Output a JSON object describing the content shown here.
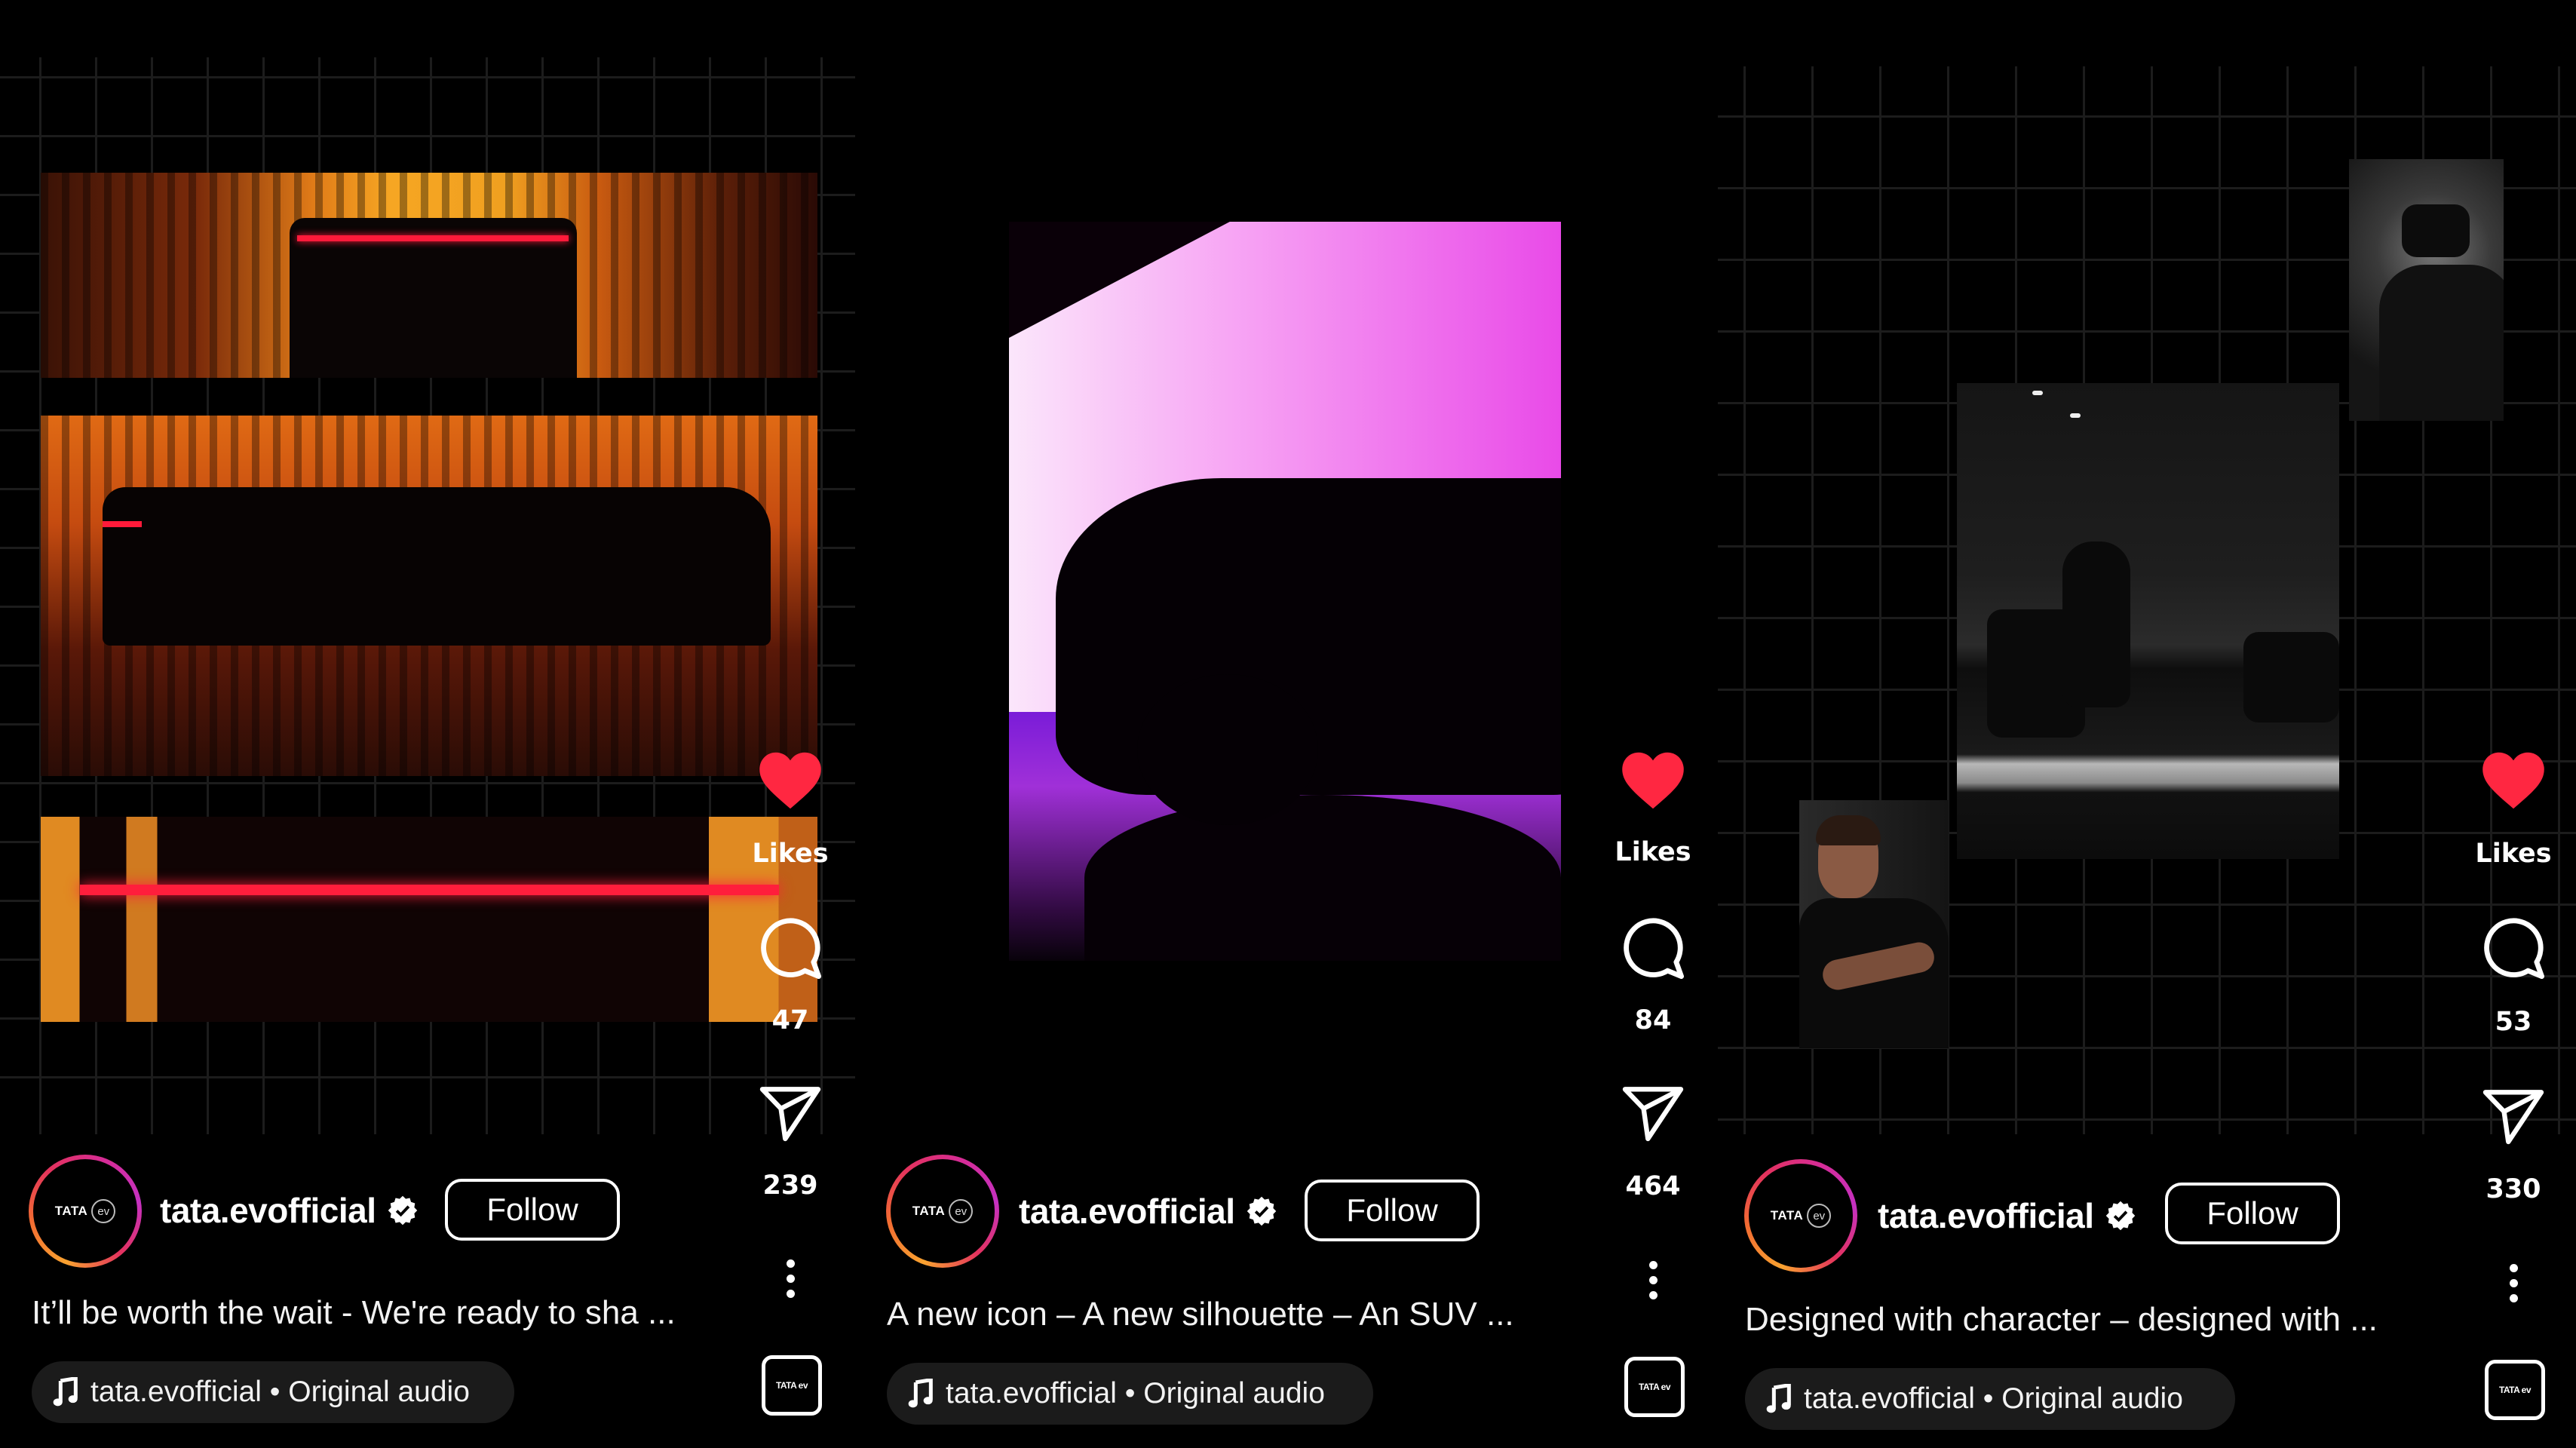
{
  "colors": {
    "background": "#000000",
    "like_red": "#ff2741",
    "text": "#ffffff",
    "pill_bg": "#1b1b1b"
  },
  "reels": [
    {
      "account": {
        "username": "tata.evofficial",
        "verified": true,
        "avatar_logo": "TATA",
        "avatar_logo_badge": "ev"
      },
      "follow_label": "Follow",
      "caption": "It’ll be worth the wait - We're ready to sha ...",
      "audio": {
        "icon": "music-note-icon",
        "text": "tata.evofficial • Original audio",
        "thumb_logo": "TATA ev"
      },
      "actions": {
        "like_icon": "heart-filled-icon",
        "likes_label": "Likes",
        "comments_icon": "comment-icon",
        "comments": "47",
        "share_icon": "send-icon",
        "shares": "239",
        "more_icon": "more-vertical-icon"
      },
      "media": "orange light-streak video frames"
    },
    {
      "account": {
        "username": "tata.evofficial",
        "verified": true,
        "avatar_logo": "TATA",
        "avatar_logo_badge": "ev"
      },
      "follow_label": "Follow",
      "caption": "A new icon – A new silhouette – An SUV ...",
      "audio": {
        "icon": "music-note-icon",
        "text": "tata.evofficial • Original audio",
        "thumb_logo": "TATA ev"
      },
      "actions": {
        "like_icon": "heart-filled-icon",
        "likes_label": "Likes",
        "comments_icon": "comment-icon",
        "comments": "84",
        "share_icon": "send-icon",
        "shares": "464",
        "more_icon": "more-vertical-icon"
      },
      "media": "SUV silhouette against pink backdrop"
    },
    {
      "account": {
        "username": "tata.evofficial",
        "verified": true,
        "avatar_logo": "TATA",
        "avatar_logo_badge": "ev"
      },
      "follow_label": "Follow",
      "caption": "Designed with character – designed with ...",
      "audio": {
        "icon": "music-note-icon",
        "text": "tata.evofficial • Original audio",
        "thumb_logo": "TATA ev"
      },
      "actions": {
        "like_icon": "heart-filled-icon",
        "likes_label": "Likes",
        "comments_icon": "comment-icon",
        "comments": "53",
        "share_icon": "send-icon",
        "shares": "330",
        "more_icon": "more-vertical-icon"
      },
      "media": "VR design studio photo collage"
    }
  ]
}
